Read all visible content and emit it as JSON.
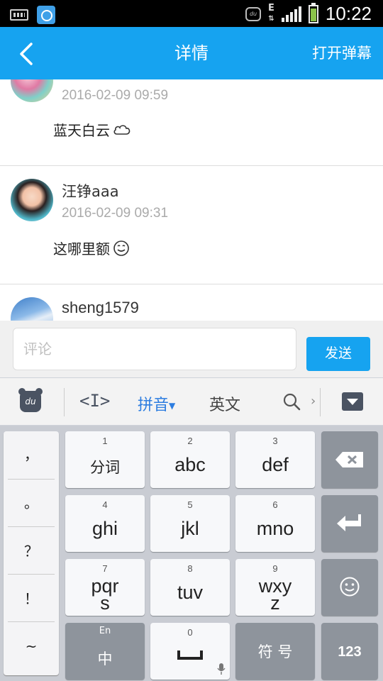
{
  "status_bar": {
    "time": "10:22",
    "network_type": "E"
  },
  "header": {
    "title": "详情",
    "action_label": "打开弹幕"
  },
  "comments": [
    {
      "username": "",
      "time": "2016-02-09 09:59",
      "text": "蓝天白云"
    },
    {
      "username": "汪铮aaa",
      "time": "2016-02-09 09:31",
      "text": "这哪里额"
    },
    {
      "username": "sheng1579",
      "time": "",
      "text": ""
    }
  ],
  "comment_input": {
    "placeholder": "评论",
    "value": ""
  },
  "send_button": "发送",
  "ime_toolbar": {
    "pinyin_label": "拼音",
    "english_label": "英文",
    "logo_text": "du"
  },
  "keyboard": {
    "punctuation": [
      "，",
      "。",
      "？",
      "！",
      "~"
    ],
    "keys": [
      {
        "number": "1",
        "label": "分词"
      },
      {
        "number": "2",
        "label": "abc"
      },
      {
        "number": "3",
        "label": "def"
      },
      {
        "number": "4",
        "label": "ghi"
      },
      {
        "number": "5",
        "label": "jkl"
      },
      {
        "number": "6",
        "label": "mno"
      },
      {
        "number": "7",
        "label": "pqr\ns"
      },
      {
        "number": "8",
        "label": "tuv"
      },
      {
        "number": "9",
        "label": "wxy\nz"
      }
    ],
    "lang_key": {
      "top": "En",
      "label": "中"
    },
    "space_key_number": "0",
    "symbol_key": "符 号",
    "num_key": "123"
  },
  "colors": {
    "accent": "#16a3f0",
    "key_dark": "#8e949c",
    "keyboard_bg": "#c9ccd3"
  }
}
